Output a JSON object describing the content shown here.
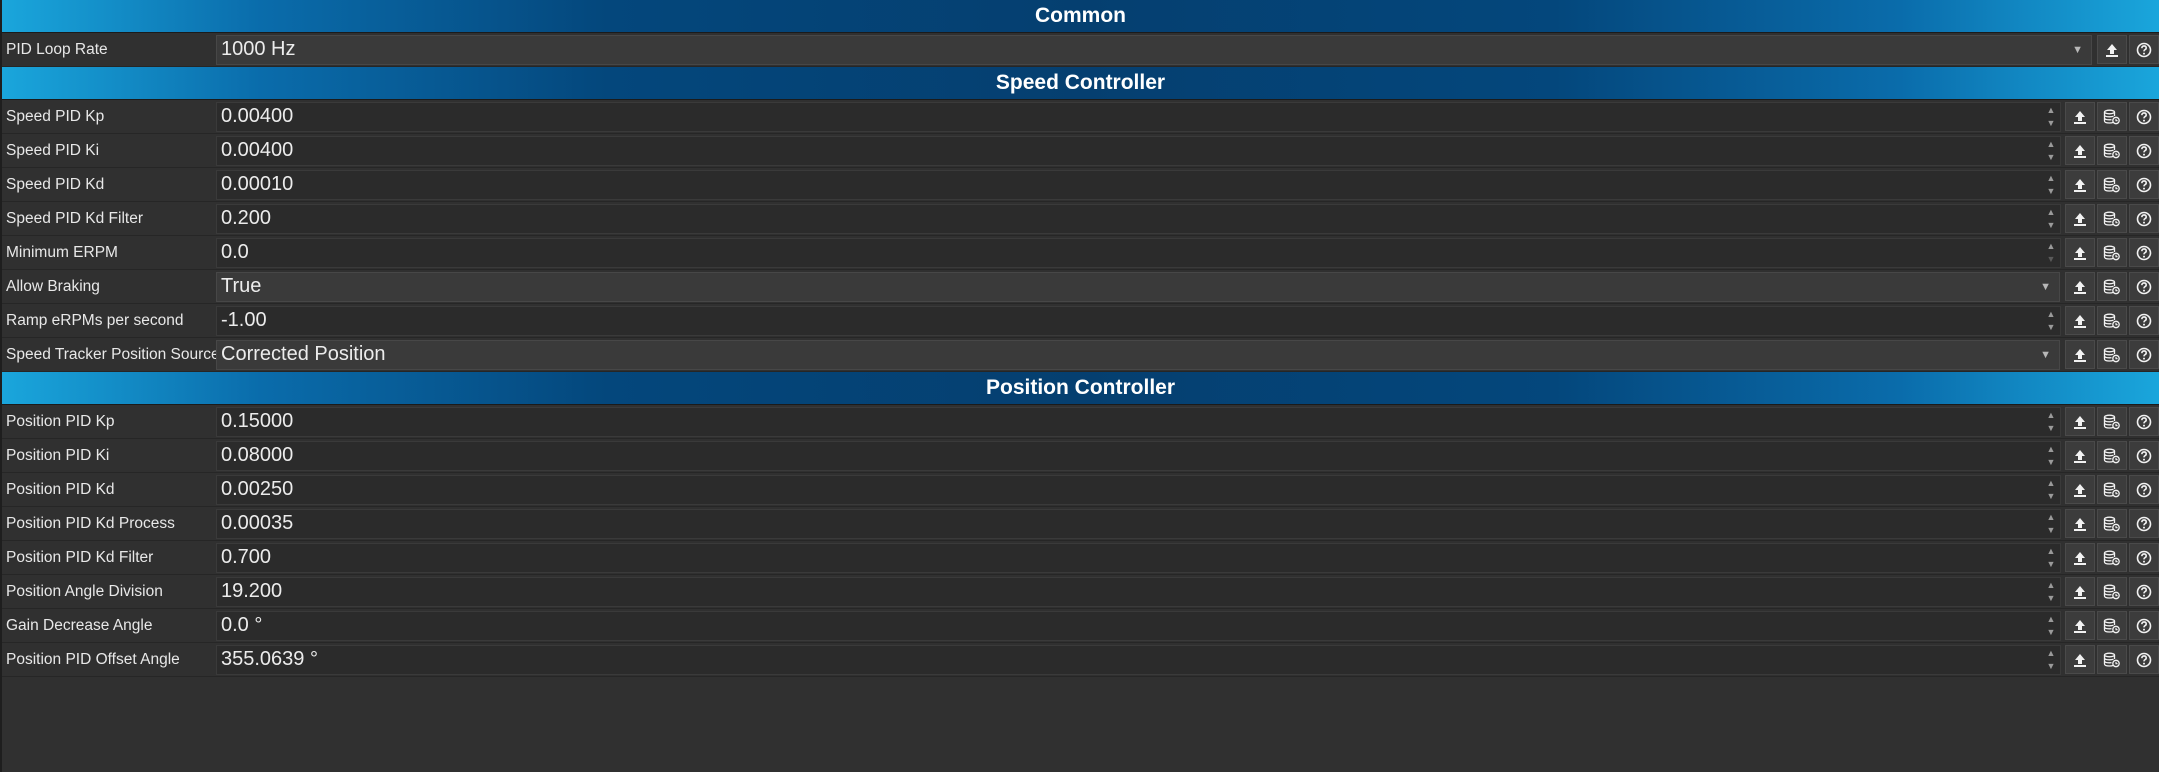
{
  "sections": {
    "common": {
      "title": "Common",
      "rows": [
        {
          "label": "PID Loop Rate",
          "value": "1000 Hz",
          "kind": "combo"
        }
      ]
    },
    "speed": {
      "title": "Speed Controller",
      "rows": [
        {
          "label": "Speed PID Kp",
          "value": "0.00400",
          "kind": "number"
        },
        {
          "label": "Speed PID Ki",
          "value": "0.00400",
          "kind": "number"
        },
        {
          "label": "Speed PID Kd",
          "value": "0.00010",
          "kind": "number"
        },
        {
          "label": "Speed PID Kd Filter",
          "value": "0.200",
          "kind": "number"
        },
        {
          "label": "Minimum ERPM",
          "value": "0.0",
          "kind": "number"
        },
        {
          "label": "Allow Braking",
          "value": "True",
          "kind": "combo"
        },
        {
          "label": "Ramp eRPMs per second",
          "value": "-1.00",
          "kind": "number"
        },
        {
          "label": "Speed Tracker Position Source",
          "value": "Corrected Position",
          "kind": "combo"
        }
      ]
    },
    "position": {
      "title": "Position Controller",
      "rows": [
        {
          "label": "Position PID Kp",
          "value": "0.15000",
          "kind": "number"
        },
        {
          "label": "Position PID Ki",
          "value": "0.08000",
          "kind": "number"
        },
        {
          "label": "Position PID Kd",
          "value": "0.00250",
          "kind": "number"
        },
        {
          "label": "Position PID Kd Process",
          "value": "0.00035",
          "kind": "number"
        },
        {
          "label": "Position PID Kd Filter",
          "value": "0.700",
          "kind": "number"
        },
        {
          "label": "Position Angle Division",
          "value": "19.200",
          "kind": "number"
        },
        {
          "label": "Gain Decrease Angle",
          "value": "0.0 °",
          "kind": "number"
        },
        {
          "label": "Position PID Offset Angle",
          "value": "355.0639 °",
          "kind": "number"
        }
      ]
    }
  },
  "icons": {
    "spin_up": "▲",
    "spin_down": "▼",
    "combo_caret": "▼"
  },
  "colors": {
    "header_dark": "#053f70",
    "header_light": "#1aa6dc",
    "background": "#303030"
  }
}
